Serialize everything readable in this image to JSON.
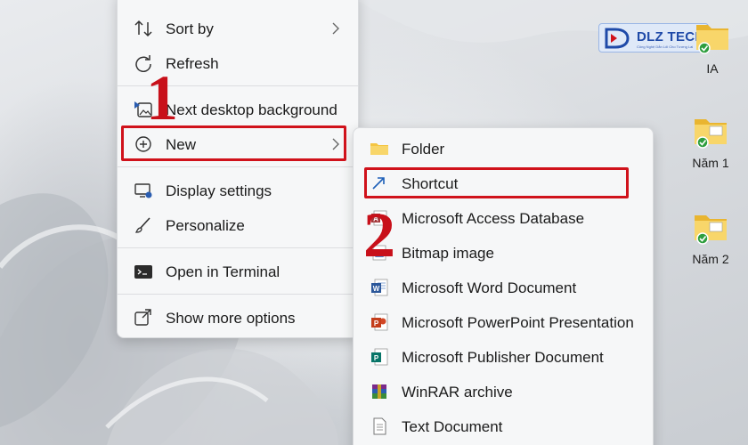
{
  "context_menu": {
    "items": [
      {
        "label": "Sort by",
        "icon": "sort-icon",
        "submenu": true
      },
      {
        "label": "Refresh",
        "icon": "refresh-icon"
      },
      {
        "label": "Next desktop background",
        "icon": "next-background-icon"
      },
      {
        "label": "New",
        "icon": "plus-circle-icon",
        "submenu": true
      },
      {
        "label": "Display settings",
        "icon": "display-settings-icon"
      },
      {
        "label": "Personalize",
        "icon": "brush-icon"
      },
      {
        "label": "Open in Terminal",
        "icon": "terminal-icon"
      },
      {
        "label": "Show more options",
        "icon": "show-more-icon"
      }
    ]
  },
  "new_submenu": {
    "items": [
      {
        "label": "Folder",
        "icon": "folder-icon"
      },
      {
        "label": "Shortcut",
        "icon": "shortcut-icon"
      },
      {
        "label": "Microsoft Access Database",
        "icon": "access-icon"
      },
      {
        "label": "Bitmap image",
        "icon": "bitmap-icon"
      },
      {
        "label": "Microsoft Word Document",
        "icon": "word-icon"
      },
      {
        "label": "Microsoft PowerPoint Presentation",
        "icon": "powerpoint-icon"
      },
      {
        "label": "Microsoft Publisher Document",
        "icon": "publisher-icon"
      },
      {
        "label": "WinRAR archive",
        "icon": "winrar-icon"
      },
      {
        "label": "Text Document",
        "icon": "text-document-icon"
      }
    ]
  },
  "annotations": {
    "step_1": "1",
    "step_2": "2",
    "highlight_color": "#d0121b"
  },
  "desktop_icons": [
    {
      "label": "IA",
      "icon": "folder-icon"
    },
    {
      "label": "Năm 1",
      "icon": "folder-icon"
    },
    {
      "label": "Năm 2",
      "icon": "folder-icon"
    }
  ],
  "logo": {
    "text": "DLZ TECH",
    "tagline": "Công Nghệ Dẫn Lối Cho Tương Lai"
  },
  "colors": {
    "accent_blue": "#1f4aa8",
    "folder_yellow": "#f4c542",
    "menu_bg": "#f6f7f8"
  }
}
